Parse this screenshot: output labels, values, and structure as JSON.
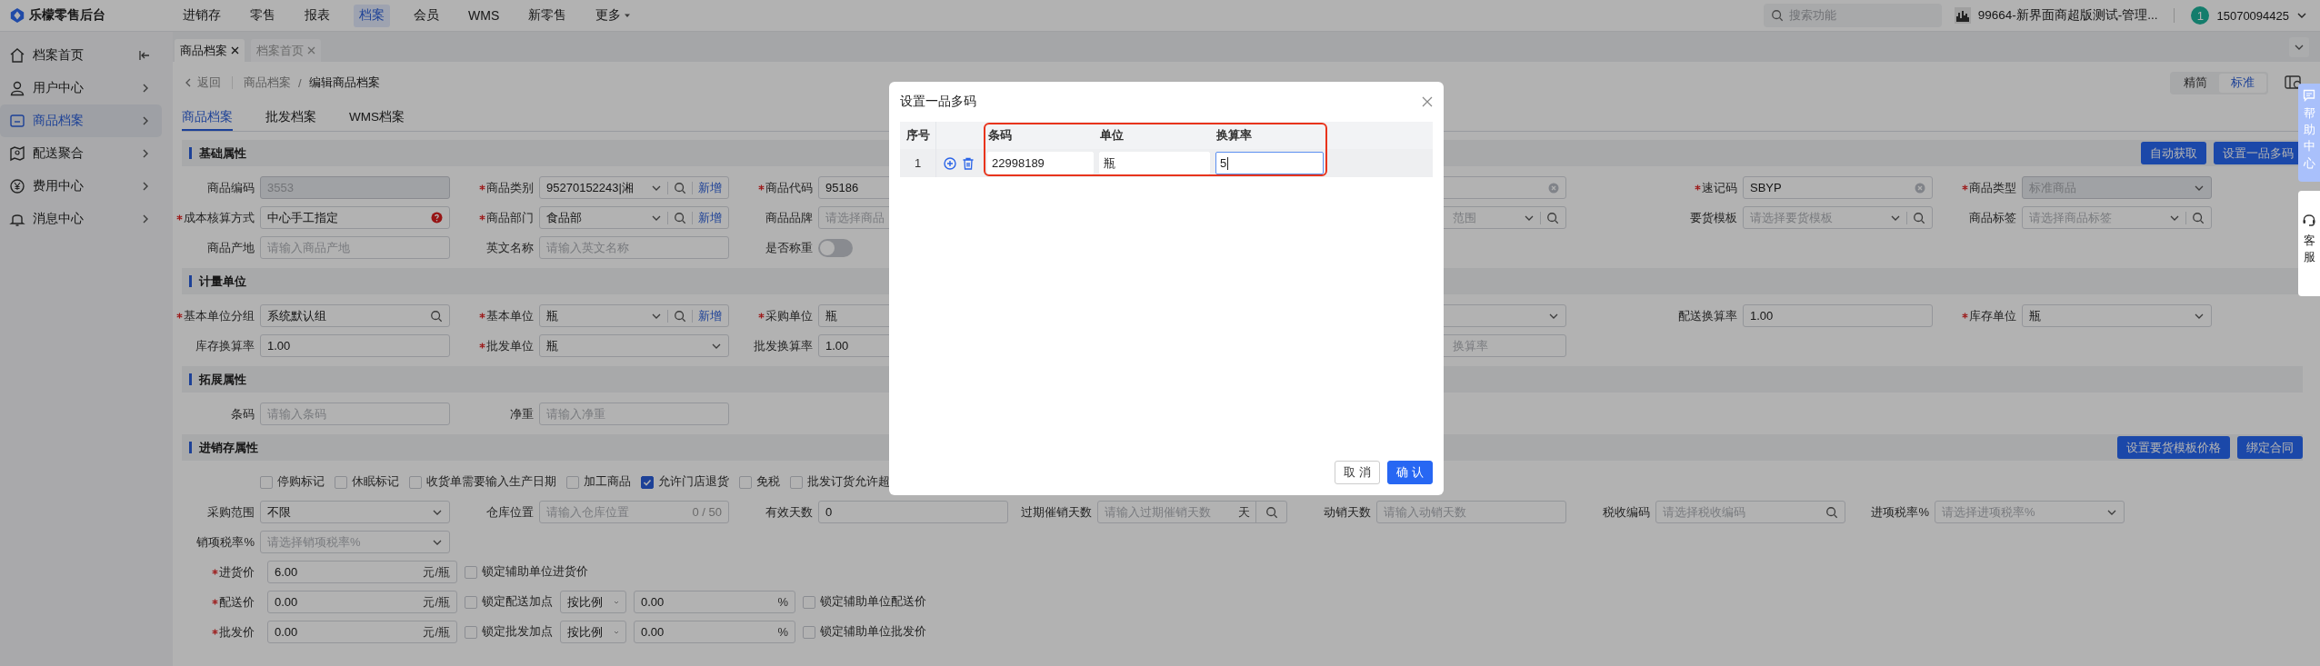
{
  "topbar": {
    "logo": "乐檬零售后台",
    "nav": [
      {
        "label": "进销存",
        "selected": false
      },
      {
        "label": "零售",
        "selected": false
      },
      {
        "label": "报表",
        "selected": false
      },
      {
        "label": "档案",
        "selected": true
      },
      {
        "label": "会员",
        "selected": false
      },
      {
        "label": "WMS",
        "selected": false
      },
      {
        "label": "新零售",
        "selected": false
      },
      {
        "label": "更多",
        "selected": false
      }
    ],
    "search": {
      "placeholder": "搜索功能"
    },
    "store": "99664-新界面商超版测试-管理...",
    "avatar": "1",
    "user": "15070094425"
  },
  "sidebar": {
    "items": [
      {
        "label": "档案首页",
        "selected": false
      },
      {
        "label": "用户中心",
        "selected": false
      },
      {
        "label": "商品档案",
        "selected": true
      },
      {
        "label": "配送聚合",
        "selected": false
      },
      {
        "label": "费用中心",
        "selected": false
      },
      {
        "label": "消息中心",
        "selected": false
      }
    ]
  },
  "tabs": [
    {
      "label": "商品档案",
      "selected": true
    },
    {
      "label": "档案首页",
      "selected": false
    }
  ],
  "breadcrumb": {
    "back": "返回",
    "parent": "商品档案",
    "separator": "/",
    "current": "编辑商品档案"
  },
  "view_mode": [
    {
      "label": "精简",
      "selected": false
    },
    {
      "label": "标准",
      "selected": true
    }
  ],
  "subtabs": [
    {
      "label": "商品档案",
      "selected": true
    },
    {
      "label": "批发档案",
      "selected": false
    },
    {
      "label": "WMS档案",
      "selected": false
    }
  ],
  "sections": [
    {
      "title": "基础属性",
      "buttons": [
        "自动获取",
        "设置一品多码"
      ],
      "rows": [
        {
          "cells": [
            {
              "label": "商品编码",
              "required": false,
              "kind": "input",
              "value": "3553",
              "disabled": true
            },
            {
              "label": "商品类别",
              "required": true,
              "kind": "select-search-add",
              "value": "95270152243|湘",
              "action": "新增",
              "disabled": false
            },
            {
              "label": "商品代码",
              "required": true,
              "kind": "input",
              "value": "95186",
              "disabled": false
            },
            {
              "kind": "blank"
            },
            {
              "kind": "clear",
              "disabled": false
            },
            {
              "label": "速记码",
              "required": true,
              "kind": "clear",
              "value": "SBYP",
              "disabled": false
            },
            {
              "label": "商品类型",
              "required": true,
              "kind": "select",
              "value": "标准商品",
              "disabled": true
            }
          ]
        },
        {
          "cells": [
            {
              "label": "成本核算方式",
              "required": true,
              "kind": "warn",
              "value": "中心手工指定",
              "disabled": false
            },
            {
              "label": "商品部门",
              "required": true,
              "kind": "select-search-add",
              "value": "食品部",
              "action": "新增",
              "disabled": false
            },
            {
              "label": "商品品牌",
              "required": false,
              "kind": "input",
              "placeholder": "请选择商品",
              "disabled": false
            },
            {
              "kind": "blank"
            },
            {
              "kind": "select-search",
              "placeholder": "范围",
              "disabled": false
            },
            {
              "label": "要货模板",
              "required": false,
              "kind": "select-search",
              "placeholder": "请选择要货模板",
              "disabled": false
            },
            {
              "label": "商品标签",
              "required": false,
              "kind": "select-search",
              "placeholder": "请选择商品标签",
              "disabled": false
            }
          ]
        },
        {
          "cells": [
            {
              "label": "商品产地",
              "required": false,
              "kind": "input",
              "placeholder": "请输入商品产地",
              "disabled": false
            },
            {
              "label": "英文名称",
              "required": false,
              "kind": "input",
              "placeholder": "请输入英文名称",
              "disabled": false
            },
            {
              "label": "是否称重",
              "required": false,
              "kind": "toggle",
              "on": false
            }
          ]
        }
      ]
    },
    {
      "title": "计量单位",
      "rows": [
        {
          "cells": [
            {
              "label": "基本单位分组",
              "required": true,
              "kind": "search",
              "value": "系统默认组",
              "disabled": false
            },
            {
              "label": "基本单位",
              "required": true,
              "kind": "select-search-add",
              "value": "瓶",
              "action": "新增",
              "disabled": false
            },
            {
              "label": "采购单位",
              "required": true,
              "kind": "input",
              "value": "瓶",
              "disabled": false
            },
            {
              "kind": "blank"
            },
            {
              "kind": "select",
              "disabled": false
            },
            {
              "label": "配送换算率",
              "required": false,
              "kind": "input",
              "value": "1.00",
              "disabled": false
            },
            {
              "label": "库存单位",
              "required": true,
              "kind": "select",
              "value": "瓶",
              "disabled": false
            }
          ]
        },
        {
          "cells": [
            {
              "label": "库存换算率",
              "required": false,
              "kind": "input",
              "value": "1.00",
              "disabled": false
            },
            {
              "label": "批发单位",
              "required": true,
              "kind": "select",
              "value": "瓶",
              "disabled": false
            },
            {
              "label": "批发换算率",
              "required": false,
              "kind": "input",
              "value": "1.00",
              "disabled": false
            },
            {
              "kind": "blank"
            },
            {
              "kind": "input",
              "placeholder": "换算率",
              "disabled": false
            }
          ]
        }
      ]
    },
    {
      "title": "拓展属性",
      "rows": [
        {
          "cells": [
            {
              "label": "条码",
              "required": false,
              "kind": "input",
              "placeholder": "请输入条码",
              "disabled": false
            },
            {
              "label": "净重",
              "required": false,
              "kind": "input",
              "placeholder": "请输入净重",
              "disabled": false
            }
          ]
        }
      ]
    },
    {
      "title": "进销存属性",
      "buttons": [
        "设置要货模板价格",
        "绑定合同"
      ],
      "checks": [
        {
          "label": "停购标记",
          "checked": false
        },
        {
          "label": "休眠标记",
          "checked": false
        },
        {
          "label": "收货单需要输入生产日期",
          "checked": false
        },
        {
          "label": "加工商品",
          "checked": false
        },
        {
          "label": "允许门店退货",
          "checked": true
        },
        {
          "label": "免税",
          "checked": false
        },
        {
          "label": "批发订货允许超",
          "checked": false
        }
      ],
      "rows": [
        {
          "cells": [
            {
              "label": "采购范围",
              "required": false,
              "kind": "select",
              "value": "不限",
              "disabled": false
            },
            {
              "label": "仓库位置",
              "required": false,
              "kind": "counter",
              "placeholder": "请输入仓库位置",
              "counter": "0 / 50",
              "disabled": false
            },
            {
              "label": "有效天数",
              "required": false,
              "kind": "input",
              "value": "0",
              "disabled": false
            },
            {
              "label": "过期催销天数",
              "required": false,
              "kind": "unit-search",
              "placeholder": "请输入过期催销天数",
              "suffix": "天",
              "disabled": false
            },
            {
              "label": "动销天数",
              "required": false,
              "kind": "input",
              "placeholder": "请输入动销天数",
              "disabled": false
            },
            {
              "label": "税收编码",
              "required": false,
              "kind": "search",
              "placeholder": "请选择税收编码",
              "disabled": false
            },
            {
              "label": "进项税率%",
              "required": false,
              "kind": "select",
              "placeholder": "请选择进项税率%",
              "disabled": false
            }
          ]
        },
        {
          "cells": [
            {
              "label": "销项税率%",
              "required": false,
              "kind": "select",
              "placeholder": "请选择销项税率%",
              "disabled": false
            }
          ]
        }
      ],
      "prices": [
        {
          "label": "进货价",
          "required": true,
          "value": "6.00",
          "suffix": "元/瓶",
          "lock": {
            "label": "锁定辅助单位进货价",
            "checked": false
          }
        },
        {
          "label": "配送价",
          "required": true,
          "value": "0.00",
          "suffix": "元/瓶",
          "markup_lock": {
            "label": "锁定配送加点",
            "checked": false
          },
          "mode": "按比例",
          "markup": "0.00",
          "markup_suffix": "%",
          "lock": {
            "label": "锁定辅助单位配送价",
            "checked": false
          }
        },
        {
          "label": "批发价",
          "required": true,
          "value": "0.00",
          "suffix": "元/瓶",
          "markup_lock": {
            "label": "锁定批发加点",
            "checked": false
          },
          "mode": "按比例",
          "markup": "0.00",
          "markup_suffix": "%",
          "lock": {
            "label": "锁定辅助单位批发价",
            "checked": false
          }
        }
      ]
    }
  ],
  "modal": {
    "title": "设置一品多码",
    "columns": [
      "序号",
      "条码",
      "单位",
      "换算率"
    ],
    "highlighted": true,
    "rows": [
      {
        "index": "1",
        "barcode": "22998189",
        "unit": "瓶",
        "rate": "5",
        "rate_focused": true
      }
    ],
    "buttons": [
      {
        "label": "取 消",
        "primary": false
      },
      {
        "label": "确 认",
        "primary": true
      }
    ]
  },
  "help_tab": "帮助中心",
  "service_tab": "客服"
}
